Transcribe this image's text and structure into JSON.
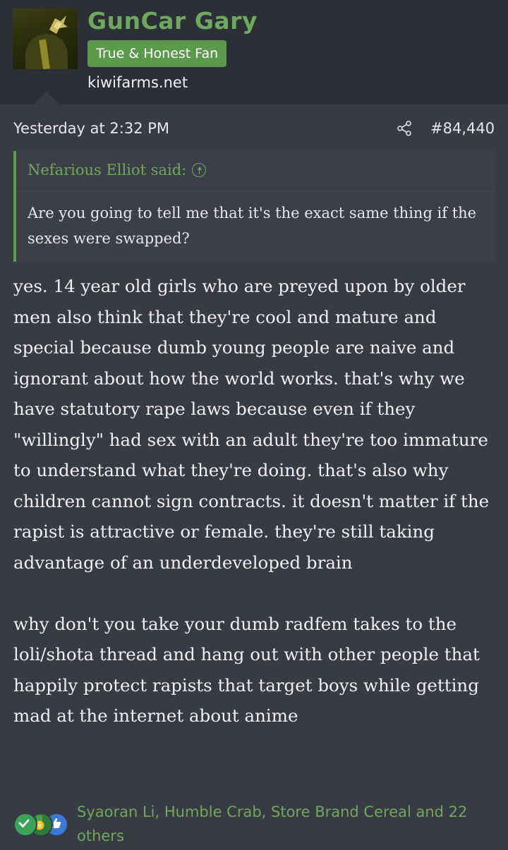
{
  "user": {
    "name": "GunCar Gary",
    "title_badge": "True & Honest Fan",
    "site": "kiwifarms.net"
  },
  "post": {
    "time": "Yesterday at 2:32 PM",
    "number": "#84,440",
    "quote": {
      "author_line": "Nefarious Elliot said:",
      "text": "Are you going to tell me that it's the exact same thing if the sexes were swapped?"
    },
    "paragraphs": [
      "yes. 14 year old girls who are preyed upon by older men also think that they're cool and mature and special because dumb young people are naive and ignorant about how the world works. that's why we have statutory rape laws because even if they \"willingly\" had sex with an adult they're too immature to understand what they're doing. that's also why children cannot sign contracts. it doesn't matter if the rapist is attractive or female. they're still taking advantage of an underdeveloped brain",
      "why don't you take your dumb radfem takes to the loli/shota thread and hang out with other people that happily protect rapists that target boys while getting mad at the internet about anime"
    ],
    "reactions": {
      "icons": [
        "check-icon",
        "medal-icon",
        "thumbs-up-icon"
      ],
      "reactors": "Syaoran Li, Humble Crab, Store Brand Cereal and 22 others"
    }
  },
  "colors": {
    "accent_green": "#6ea85e",
    "badge_green": "#5b9a4c",
    "background": "#2d2f36",
    "post_background": "#393b44"
  }
}
